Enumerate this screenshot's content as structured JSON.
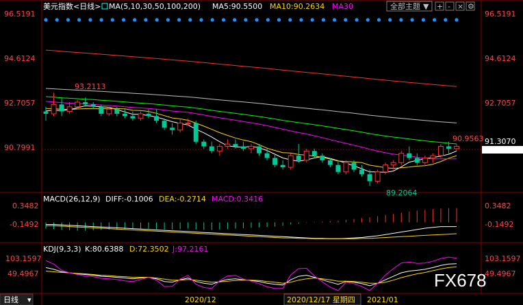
{
  "header": {
    "instrument": "美元指数<日线>",
    "ma_label": "MA(5,10,30,50,100,200)",
    "ma5": "MA5:90.5500",
    "ma10": "MA10:90.2634",
    "ma30": "MA30",
    "theme_button": "全部主题"
  },
  "price_panel": {
    "left_ticks": [
      "96.5191",
      "94.6124",
      "92.7057",
      "90.7991"
    ],
    "right_ticks": [
      "96.5191",
      "94.6124",
      "92.7057"
    ],
    "right_current": "91.3070",
    "high_label": "93.2113",
    "low_label": "89.2064",
    "last_label": "90.9563"
  },
  "macd_panel": {
    "title": "MACD(26,12,9)",
    "diff": "DIFF:-0.1006",
    "dea": "DEA:-0.2714",
    "macd": "MACD:0.3416",
    "ticks": [
      "0.3482",
      "-0.1492"
    ]
  },
  "kdj_panel": {
    "title": "KDJ(9,3,3)",
    "k": "K:80.6388",
    "d": "D:72.3502",
    "j": "J:97.2161",
    "ticks": [
      "103.1597",
      "49.4967"
    ]
  },
  "footer": {
    "period": "日线",
    "dates": [
      "2020/12",
      "2020/12/17 星期四",
      "2021/01"
    ]
  },
  "watermark": "FX678",
  "colors": {
    "up": "#ff3232",
    "down": "#00c896",
    "ma5": "#ffffff",
    "ma10": "#ffd700",
    "ma30": "#ff00ff",
    "ma50": "#00ff00",
    "ma100": "#c0c0c0",
    "ma200": "#ff3030",
    "grid": "#8b0000",
    "dots": "#1e90ff"
  },
  "chart_data": {
    "type": "candlestick",
    "ylim": [
      89.0,
      96.6
    ],
    "candles": [
      [
        92.4,
        92.6,
        92.0,
        92.3
      ],
      [
        92.3,
        93.2,
        92.2,
        92.7
      ],
      [
        92.7,
        93.0,
        92.2,
        92.4
      ],
      [
        92.4,
        92.8,
        92.3,
        92.6
      ],
      [
        92.6,
        92.9,
        92.5,
        92.8
      ],
      [
        92.8,
        93.0,
        92.6,
        92.7
      ],
      [
        92.7,
        92.8,
        92.5,
        92.6
      ],
      [
        92.6,
        92.7,
        92.2,
        92.3
      ],
      [
        92.3,
        92.6,
        92.2,
        92.5
      ],
      [
        92.5,
        92.6,
        92.2,
        92.3
      ],
      [
        92.3,
        92.5,
        92.1,
        92.2
      ],
      [
        92.2,
        92.4,
        92.0,
        92.1
      ],
      [
        92.1,
        92.4,
        92.0,
        92.3
      ],
      [
        92.3,
        92.5,
        92.1,
        92.2
      ],
      [
        92.2,
        92.5,
        91.9,
        92.0
      ],
      [
        92.0,
        92.1,
        91.6,
        91.7
      ],
      [
        91.7,
        91.9,
        91.4,
        91.6
      ],
      [
        91.6,
        92.1,
        91.5,
        91.9
      ],
      [
        91.9,
        92.1,
        91.8,
        91.9
      ],
      [
        91.9,
        92.0,
        91.0,
        91.1
      ],
      [
        91.1,
        91.2,
        90.8,
        90.9
      ],
      [
        90.9,
        91.1,
        90.6,
        90.7
      ],
      [
        90.7,
        91.0,
        90.5,
        90.9
      ],
      [
        90.9,
        91.2,
        90.8,
        91.0
      ],
      [
        91.0,
        91.2,
        90.8,
        90.9
      ],
      [
        90.9,
        91.1,
        90.7,
        90.8
      ],
      [
        90.8,
        91.0,
        90.6,
        90.9
      ],
      [
        90.9,
        91.0,
        90.5,
        90.6
      ],
      [
        90.6,
        90.8,
        90.3,
        90.4
      ],
      [
        90.4,
        90.6,
        90.0,
        90.1
      ],
      [
        90.1,
        90.3,
        89.9,
        90.0
      ],
      [
        90.0,
        90.6,
        89.9,
        90.5
      ],
      [
        90.5,
        91.0,
        90.2,
        90.3
      ],
      [
        90.3,
        90.8,
        90.2,
        90.7
      ],
      [
        90.7,
        90.8,
        90.4,
        90.5
      ],
      [
        90.5,
        90.6,
        90.2,
        90.3
      ],
      [
        90.3,
        90.4,
        90.0,
        90.1
      ],
      [
        90.1,
        90.3,
        89.7,
        89.8
      ],
      [
        89.8,
        90.3,
        89.7,
        90.2
      ],
      [
        90.2,
        90.3,
        89.8,
        89.9
      ],
      [
        89.9,
        90.1,
        89.6,
        89.7
      ],
      [
        89.7,
        89.9,
        89.2,
        89.4
      ],
      [
        89.4,
        89.9,
        89.3,
        89.8
      ],
      [
        89.8,
        90.2,
        89.7,
        90.1
      ],
      [
        90.1,
        90.3,
        89.9,
        90.2
      ],
      [
        90.2,
        90.7,
        90.1,
        90.6
      ],
      [
        90.6,
        90.9,
        90.3,
        90.4
      ],
      [
        90.4,
        90.6,
        90.1,
        90.2
      ],
      [
        90.2,
        90.5,
        90.1,
        90.4
      ],
      [
        90.4,
        90.6,
        90.2,
        90.5
      ],
      [
        90.5,
        91.0,
        90.4,
        90.9
      ],
      [
        90.9,
        91.1,
        90.6,
        90.8
      ],
      [
        90.8,
        91.0,
        90.7,
        90.9
      ]
    ],
    "macd_hist": [
      -0.15,
      -0.16,
      -0.18,
      -0.19,
      -0.2,
      -0.2,
      -0.19,
      -0.18,
      -0.17,
      -0.17,
      -0.16,
      -0.16,
      -0.15,
      -0.15,
      -0.16,
      -0.17,
      -0.17,
      -0.16,
      -0.15,
      -0.17,
      -0.18,
      -0.18,
      -0.17,
      -0.16,
      -0.15,
      -0.14,
      -0.13,
      -0.12,
      -0.11,
      -0.1,
      -0.08,
      -0.05,
      -0.03,
      -0.01,
      0.01,
      0.02,
      0.03,
      0.04,
      0.06,
      0.08,
      0.1,
      0.12,
      0.15,
      0.18,
      0.2,
      0.23,
      0.26,
      0.28,
      0.3,
      0.32,
      0.33,
      0.34,
      0.34
    ],
    "diff": [
      -0.05,
      -0.05,
      -0.06,
      -0.07,
      -0.08,
      -0.09,
      -0.1,
      -0.11,
      -0.12,
      -0.13,
      -0.14,
      -0.15,
      -0.16,
      -0.17,
      -0.18,
      -0.19,
      -0.2,
      -0.21,
      -0.22,
      -0.23,
      -0.24,
      -0.25,
      -0.26,
      -0.27,
      -0.28,
      -0.29,
      -0.3,
      -0.31,
      -0.32,
      -0.33,
      -0.34,
      -0.35,
      -0.36,
      -0.37,
      -0.38,
      -0.38,
      -0.39,
      -0.39,
      -0.38,
      -0.37,
      -0.36,
      -0.34,
      -0.32,
      -0.29,
      -0.26,
      -0.23,
      -0.2,
      -0.17,
      -0.14,
      -0.12,
      -0.1,
      -0.1,
      -0.1
    ],
    "dea": [
      -0.08,
      -0.08,
      -0.09,
      -0.1,
      -0.11,
      -0.12,
      -0.13,
      -0.14,
      -0.15,
      -0.16,
      -0.17,
      -0.18,
      -0.19,
      -0.2,
      -0.21,
      -0.22,
      -0.23,
      -0.24,
      -0.25,
      -0.26,
      -0.27,
      -0.28,
      -0.29,
      -0.3,
      -0.31,
      -0.32,
      -0.33,
      -0.34,
      -0.35,
      -0.36,
      -0.37,
      -0.37,
      -0.38,
      -0.38,
      -0.39,
      -0.39,
      -0.39,
      -0.39,
      -0.39,
      -0.39,
      -0.38,
      -0.38,
      -0.37,
      -0.36,
      -0.35,
      -0.34,
      -0.33,
      -0.32,
      -0.31,
      -0.3,
      -0.29,
      -0.28,
      -0.27
    ],
    "kdj_k": [
      70,
      65,
      58,
      55,
      52,
      50,
      48,
      45,
      44,
      42,
      40,
      38,
      40,
      42,
      38,
      30,
      28,
      35,
      40,
      30,
      25,
      22,
      30,
      36,
      38,
      35,
      33,
      30,
      25,
      22,
      20,
      35,
      45,
      48,
      42,
      35,
      28,
      22,
      30,
      28,
      24,
      18,
      25,
      35,
      45,
      55,
      60,
      62,
      65,
      70,
      76,
      80,
      81
    ],
    "kdj_d": [
      60,
      58,
      56,
      55,
      53,
      52,
      50,
      48,
      47,
      45,
      44,
      42,
      42,
      42,
      40,
      37,
      34,
      34,
      36,
      34,
      31,
      28,
      29,
      31,
      33,
      34,
      34,
      33,
      30,
      28,
      25,
      28,
      34,
      38,
      40,
      38,
      35,
      31,
      31,
      30,
      28,
      25,
      25,
      28,
      34,
      41,
      47,
      52,
      56,
      61,
      66,
      70,
      72
    ],
    "kdj_j": [
      90,
      80,
      62,
      55,
      50,
      46,
      44,
      39,
      38,
      36,
      32,
      30,
      36,
      42,
      34,
      16,
      16,
      37,
      48,
      22,
      13,
      10,
      32,
      46,
      48,
      37,
      31,
      24,
      15,
      10,
      10,
      49,
      67,
      68,
      46,
      29,
      14,
      4,
      28,
      24,
      16,
      4,
      25,
      49,
      67,
      83,
      86,
      82,
      83,
      88,
      96,
      100,
      97
    ]
  }
}
